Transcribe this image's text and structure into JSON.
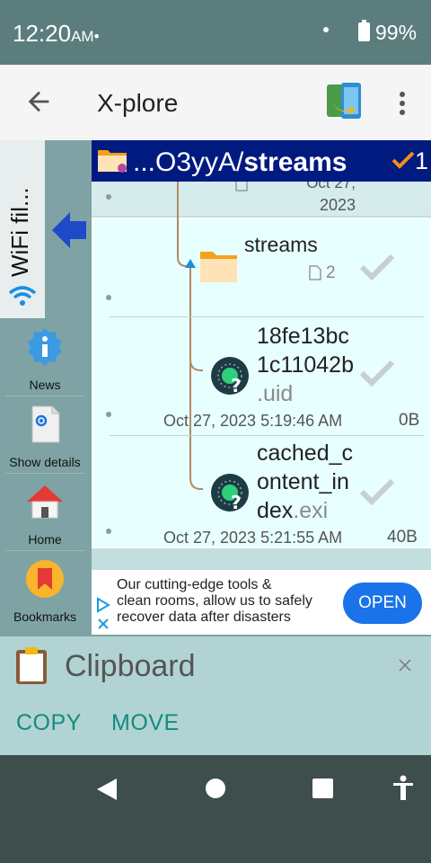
{
  "status": {
    "time": "12:20",
    "ampm": "AM",
    "battery": "99%"
  },
  "app_bar": {
    "title": "X-plore"
  },
  "side": {
    "wifi_label": "WiFi fil...",
    "items": [
      {
        "label": "News"
      },
      {
        "label": "Show details"
      },
      {
        "label": "Home"
      },
      {
        "label": "Bookmarks"
      }
    ]
  },
  "path": {
    "prefix": "...O3yyA/",
    "current": "streams",
    "selected_count": "1"
  },
  "partial_row": {
    "date": "Oct 27,",
    "date2": "2023"
  },
  "rows": [
    {
      "name": "streams",
      "sub_count": "2"
    },
    {
      "name_line1": "18fe13bc",
      "name_line2": "1c11042b",
      "ext": ".uid",
      "date": "Oct 27, 2023 5:19:46 AM",
      "size": "0B"
    },
    {
      "name_line1": "cached_c",
      "name_line2": "ontent_in",
      "name_line3": "dex",
      "ext": ".exi",
      "date": "Oct 27, 2023 5:21:55 AM",
      "size": "40B"
    }
  ],
  "ad": {
    "line1": "Our cutting-edge tools &",
    "line2": "clean rooms, allow us to safely",
    "line3": "recover data after disasters",
    "button": "OPEN"
  },
  "clipboard": {
    "title": "Clipboard",
    "copy": "COPY",
    "move": "MOVE"
  },
  "colors": {
    "accent": "#128c7e",
    "path_bar": "#001a80",
    "ad_button": "#1a73e8"
  }
}
